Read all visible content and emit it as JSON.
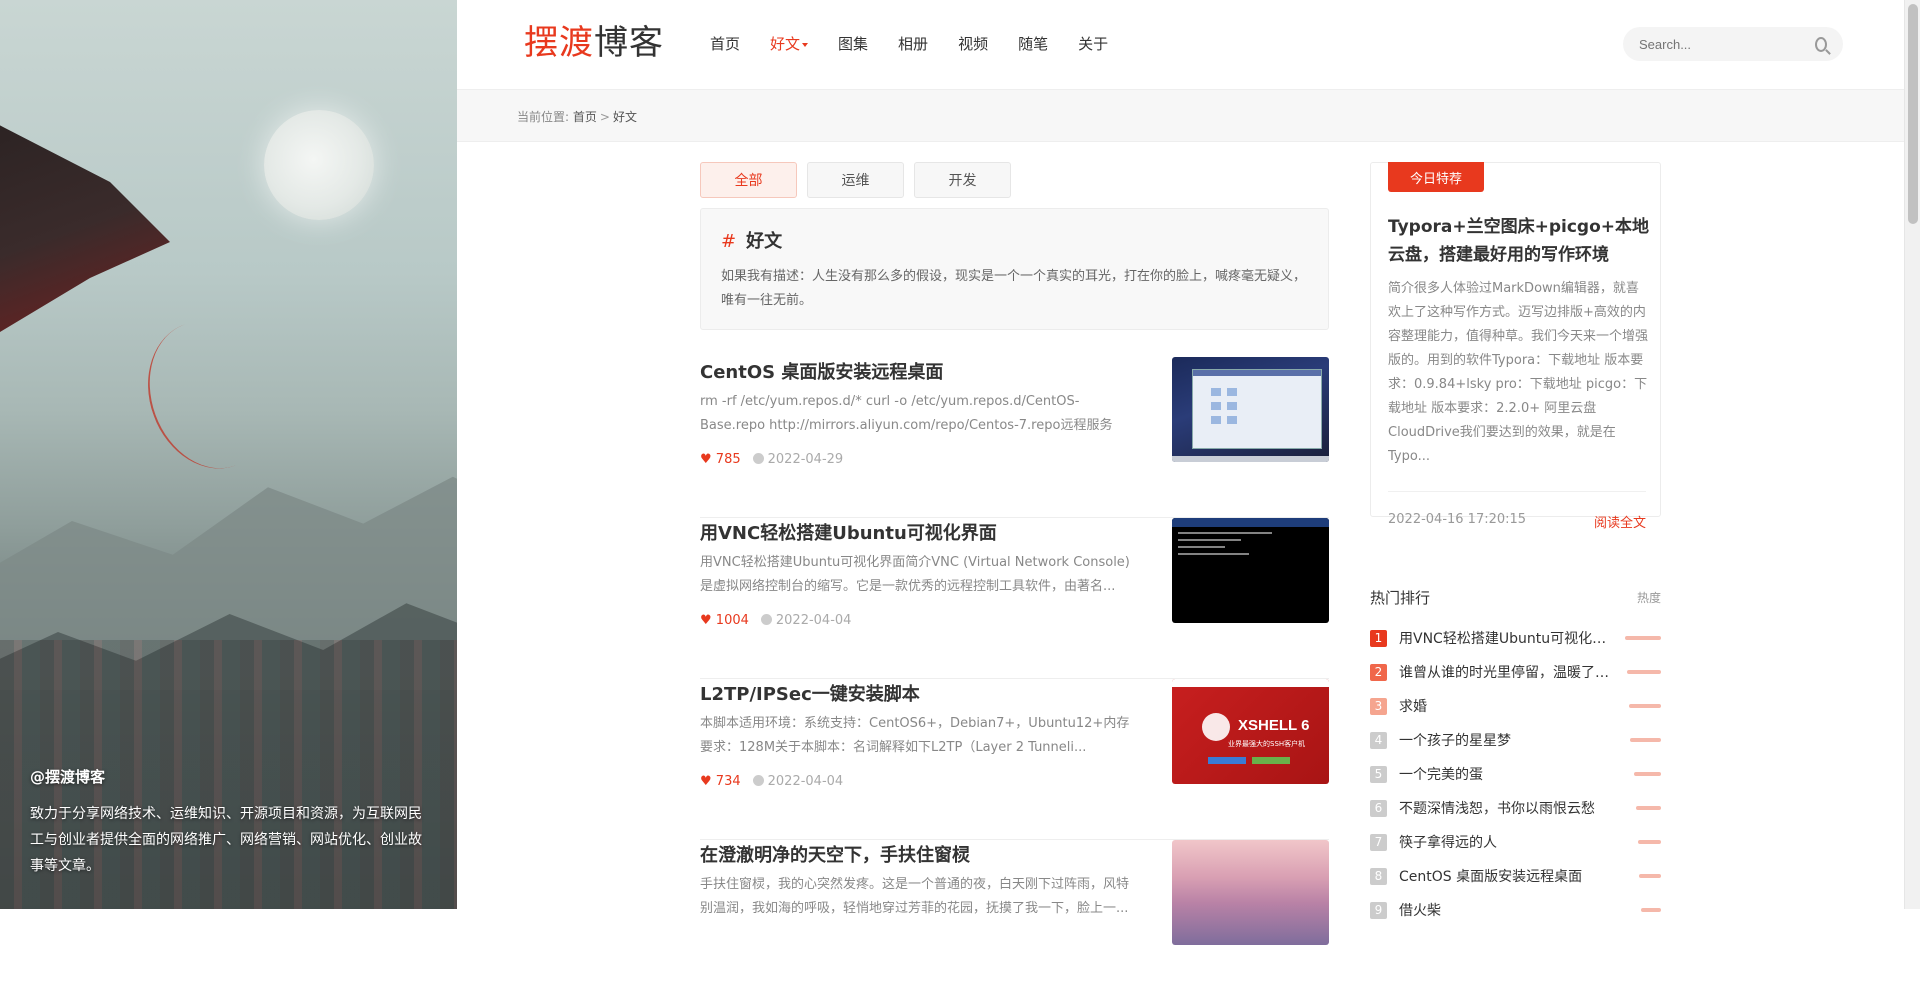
{
  "hero": {
    "title": "@摆渡博客",
    "description": "致力于分享网络技术、运维知识、开源项目和资源，为互联网民工与创业者提供全面的网络推广、网络营销、网站优化、创业故事等文章。"
  },
  "header": {
    "logo_red": "摆渡",
    "logo_dark": "博客",
    "nav": [
      {
        "label": "首页"
      },
      {
        "label": "好文",
        "active": true
      },
      {
        "label": "图集"
      },
      {
        "label": "相册"
      },
      {
        "label": "视频"
      },
      {
        "label": "随笔"
      },
      {
        "label": "关于"
      }
    ],
    "search_placeholder": "Search..."
  },
  "breadcrumb": {
    "prefix": "当前位置:",
    "home": "首页",
    "separator": ">",
    "current": "好文"
  },
  "tabs": [
    {
      "label": "全部",
      "active": true
    },
    {
      "label": "运维"
    },
    {
      "label": "开发"
    }
  ],
  "category": {
    "hash": "#",
    "title": "好文",
    "description": "如果我有描述：人生没有那么多的假设，现实是一个一个真实的耳光，打在你的脸上，喊疼毫无疑义，唯有一往无前。"
  },
  "posts": [
    {
      "title": "CentOS 桌面版安装远程桌面",
      "excerpt": "rm -rf /etc/yum.repos.d/* curl -o /etc/yum.repos.d/CentOS-Base.repo http://mirrors.aliyun.com/repo/Centos-7.repo远程服务设...",
      "likes": "785",
      "date": "2022-04-29"
    },
    {
      "title": "用VNC轻松搭建Ubuntu可视化界面",
      "excerpt": "用VNC轻松搭建Ubuntu可视化界面简介VNC (Virtual Network Console)是虚拟网络控制台的缩写。它是一款优秀的远程控制工具软件，由著名...",
      "likes": "1004",
      "date": "2022-04-04"
    },
    {
      "title": "L2TP/IPSec一键安装脚本",
      "excerpt": "本脚本适用环境：系统支持：CentOS6+，Debian7+，Ubuntu12+内存要求：128M关于本脚本：名词解释如下L2TP（Layer 2 Tunneli...",
      "likes": "734",
      "date": "2022-04-04",
      "thumb_title": "XSHELL 6",
      "thumb_sub": "业界最强大的SSH客户机"
    },
    {
      "title": "在澄澈明净的天空下，手扶住窗棂",
      "excerpt": "手扶住窗棂，我的心突然发疼。这是一个普通的夜，白天刚下过阵雨，风特别温润，我如海的呼吸，轻悄地穿过芳菲的花园，抚摸了我一下，脸上一...",
      "likes": "",
      "date": ""
    }
  ],
  "featured": {
    "badge": "今日特荐",
    "title": "Typora+兰空图床+picgo+本地云盘，搭建最好用的写作环境",
    "description": "简介很多人体验过MarkDown编辑器，就喜欢上了这种写作方式。迈写边排版+高效的内容整理能力，值得种草。我们今天来一个增强版的。用到的软件Typora：下载地址 版本要求：0.9.84+lsky pro：下载地址 picgo：下载地址 版本要求：2.2.0+ 阿里云盘CloudDrive我们要达到的效果，就是在Typo...",
    "date": "2022-04-16 17:20:15",
    "read_more": "阅读全文"
  },
  "hot": {
    "title": "热门排行",
    "subtitle": "热度",
    "items": [
      {
        "rank": "1",
        "title": "用VNC轻松搭建Ubuntu可视化界面",
        "heat": 1.0
      },
      {
        "rank": "2",
        "title": "谁曾从谁的时光里停留，温暖了流年",
        "heat": 0.95
      },
      {
        "rank": "3",
        "title": "求婚",
        "heat": 0.9
      },
      {
        "rank": "4",
        "title": "一个孩子的星星梦",
        "heat": 0.85
      },
      {
        "rank": "5",
        "title": "一个完美的蛋",
        "heat": 0.75
      },
      {
        "rank": "6",
        "title": "不题深情浅恕，书你以雨恨云愁",
        "heat": 0.7
      },
      {
        "rank": "7",
        "title": "筷子拿得远的人",
        "heat": 0.65
      },
      {
        "rank": "8",
        "title": "CentOS 桌面版安装远程桌面",
        "heat": 0.6
      },
      {
        "rank": "9",
        "title": "借火柴",
        "heat": 0.55
      }
    ]
  }
}
